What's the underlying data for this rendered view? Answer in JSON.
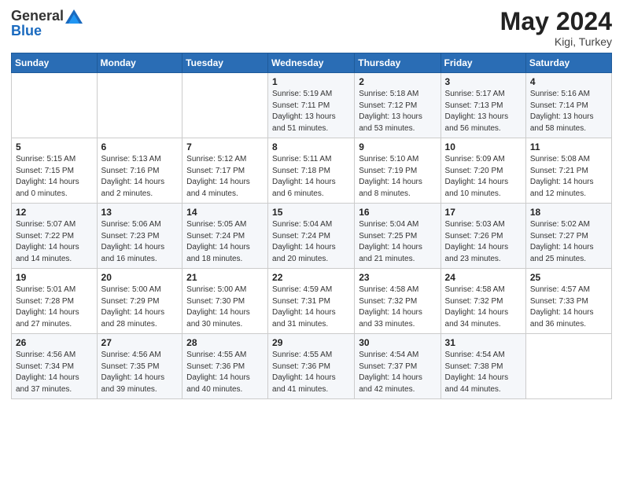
{
  "header": {
    "logo_general": "General",
    "logo_blue": "Blue",
    "month": "May 2024",
    "location": "Kigi, Turkey"
  },
  "days_of_week": [
    "Sunday",
    "Monday",
    "Tuesday",
    "Wednesday",
    "Thursday",
    "Friday",
    "Saturday"
  ],
  "weeks": [
    [
      {
        "day": "",
        "sunrise": "",
        "sunset": "",
        "daylight": ""
      },
      {
        "day": "",
        "sunrise": "",
        "sunset": "",
        "daylight": ""
      },
      {
        "day": "",
        "sunrise": "",
        "sunset": "",
        "daylight": ""
      },
      {
        "day": "1",
        "sunrise": "Sunrise: 5:19 AM",
        "sunset": "Sunset: 7:11 PM",
        "daylight": "Daylight: 13 hours and 51 minutes."
      },
      {
        "day": "2",
        "sunrise": "Sunrise: 5:18 AM",
        "sunset": "Sunset: 7:12 PM",
        "daylight": "Daylight: 13 hours and 53 minutes."
      },
      {
        "day": "3",
        "sunrise": "Sunrise: 5:17 AM",
        "sunset": "Sunset: 7:13 PM",
        "daylight": "Daylight: 13 hours and 56 minutes."
      },
      {
        "day": "4",
        "sunrise": "Sunrise: 5:16 AM",
        "sunset": "Sunset: 7:14 PM",
        "daylight": "Daylight: 13 hours and 58 minutes."
      }
    ],
    [
      {
        "day": "5",
        "sunrise": "Sunrise: 5:15 AM",
        "sunset": "Sunset: 7:15 PM",
        "daylight": "Daylight: 14 hours and 0 minutes."
      },
      {
        "day": "6",
        "sunrise": "Sunrise: 5:13 AM",
        "sunset": "Sunset: 7:16 PM",
        "daylight": "Daylight: 14 hours and 2 minutes."
      },
      {
        "day": "7",
        "sunrise": "Sunrise: 5:12 AM",
        "sunset": "Sunset: 7:17 PM",
        "daylight": "Daylight: 14 hours and 4 minutes."
      },
      {
        "day": "8",
        "sunrise": "Sunrise: 5:11 AM",
        "sunset": "Sunset: 7:18 PM",
        "daylight": "Daylight: 14 hours and 6 minutes."
      },
      {
        "day": "9",
        "sunrise": "Sunrise: 5:10 AM",
        "sunset": "Sunset: 7:19 PM",
        "daylight": "Daylight: 14 hours and 8 minutes."
      },
      {
        "day": "10",
        "sunrise": "Sunrise: 5:09 AM",
        "sunset": "Sunset: 7:20 PM",
        "daylight": "Daylight: 14 hours and 10 minutes."
      },
      {
        "day": "11",
        "sunrise": "Sunrise: 5:08 AM",
        "sunset": "Sunset: 7:21 PM",
        "daylight": "Daylight: 14 hours and 12 minutes."
      }
    ],
    [
      {
        "day": "12",
        "sunrise": "Sunrise: 5:07 AM",
        "sunset": "Sunset: 7:22 PM",
        "daylight": "Daylight: 14 hours and 14 minutes."
      },
      {
        "day": "13",
        "sunrise": "Sunrise: 5:06 AM",
        "sunset": "Sunset: 7:23 PM",
        "daylight": "Daylight: 14 hours and 16 minutes."
      },
      {
        "day": "14",
        "sunrise": "Sunrise: 5:05 AM",
        "sunset": "Sunset: 7:24 PM",
        "daylight": "Daylight: 14 hours and 18 minutes."
      },
      {
        "day": "15",
        "sunrise": "Sunrise: 5:04 AM",
        "sunset": "Sunset: 7:24 PM",
        "daylight": "Daylight: 14 hours and 20 minutes."
      },
      {
        "day": "16",
        "sunrise": "Sunrise: 5:04 AM",
        "sunset": "Sunset: 7:25 PM",
        "daylight": "Daylight: 14 hours and 21 minutes."
      },
      {
        "day": "17",
        "sunrise": "Sunrise: 5:03 AM",
        "sunset": "Sunset: 7:26 PM",
        "daylight": "Daylight: 14 hours and 23 minutes."
      },
      {
        "day": "18",
        "sunrise": "Sunrise: 5:02 AM",
        "sunset": "Sunset: 7:27 PM",
        "daylight": "Daylight: 14 hours and 25 minutes."
      }
    ],
    [
      {
        "day": "19",
        "sunrise": "Sunrise: 5:01 AM",
        "sunset": "Sunset: 7:28 PM",
        "daylight": "Daylight: 14 hours and 27 minutes."
      },
      {
        "day": "20",
        "sunrise": "Sunrise: 5:00 AM",
        "sunset": "Sunset: 7:29 PM",
        "daylight": "Daylight: 14 hours and 28 minutes."
      },
      {
        "day": "21",
        "sunrise": "Sunrise: 5:00 AM",
        "sunset": "Sunset: 7:30 PM",
        "daylight": "Daylight: 14 hours and 30 minutes."
      },
      {
        "day": "22",
        "sunrise": "Sunrise: 4:59 AM",
        "sunset": "Sunset: 7:31 PM",
        "daylight": "Daylight: 14 hours and 31 minutes."
      },
      {
        "day": "23",
        "sunrise": "Sunrise: 4:58 AM",
        "sunset": "Sunset: 7:32 PM",
        "daylight": "Daylight: 14 hours and 33 minutes."
      },
      {
        "day": "24",
        "sunrise": "Sunrise: 4:58 AM",
        "sunset": "Sunset: 7:32 PM",
        "daylight": "Daylight: 14 hours and 34 minutes."
      },
      {
        "day": "25",
        "sunrise": "Sunrise: 4:57 AM",
        "sunset": "Sunset: 7:33 PM",
        "daylight": "Daylight: 14 hours and 36 minutes."
      }
    ],
    [
      {
        "day": "26",
        "sunrise": "Sunrise: 4:56 AM",
        "sunset": "Sunset: 7:34 PM",
        "daylight": "Daylight: 14 hours and 37 minutes."
      },
      {
        "day": "27",
        "sunrise": "Sunrise: 4:56 AM",
        "sunset": "Sunset: 7:35 PM",
        "daylight": "Daylight: 14 hours and 39 minutes."
      },
      {
        "day": "28",
        "sunrise": "Sunrise: 4:55 AM",
        "sunset": "Sunset: 7:36 PM",
        "daylight": "Daylight: 14 hours and 40 minutes."
      },
      {
        "day": "29",
        "sunrise": "Sunrise: 4:55 AM",
        "sunset": "Sunset: 7:36 PM",
        "daylight": "Daylight: 14 hours and 41 minutes."
      },
      {
        "day": "30",
        "sunrise": "Sunrise: 4:54 AM",
        "sunset": "Sunset: 7:37 PM",
        "daylight": "Daylight: 14 hours and 42 minutes."
      },
      {
        "day": "31",
        "sunrise": "Sunrise: 4:54 AM",
        "sunset": "Sunset: 7:38 PM",
        "daylight": "Daylight: 14 hours and 44 minutes."
      },
      {
        "day": "",
        "sunrise": "",
        "sunset": "",
        "daylight": ""
      }
    ]
  ]
}
